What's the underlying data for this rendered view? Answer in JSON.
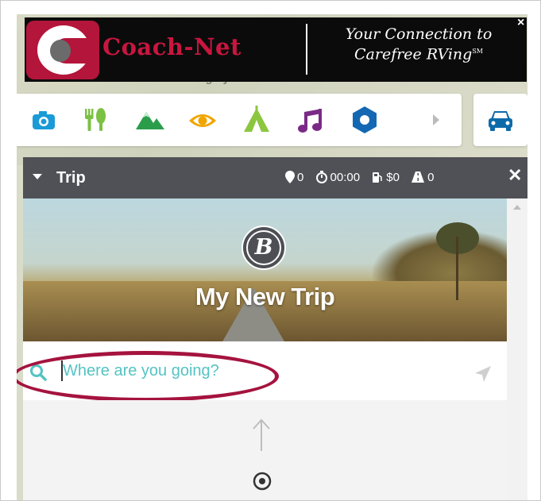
{
  "map": {
    "city_label": "Calgary"
  },
  "ad": {
    "brand": "Coach-Net",
    "tagline_line1": "Your Connection to",
    "tagline_line2": "Carefree RVing",
    "tagline_mark": "SM",
    "close_label": "×",
    "brand_color": "#c8163f"
  },
  "toolbar": {
    "categories": [
      {
        "icon": "camera-icon",
        "color": "#1a9bd7"
      },
      {
        "icon": "food-icon",
        "color": "#7bc142"
      },
      {
        "icon": "mountain-icon",
        "color": "#2a9d4b"
      },
      {
        "icon": "eye-icon",
        "color": "#f0a500"
      },
      {
        "icon": "tent-icon",
        "color": "#8cc63f"
      },
      {
        "icon": "music-icon",
        "color": "#7a2a86"
      },
      {
        "icon": "hexagon-icon",
        "color": "#1468b3"
      },
      {
        "icon": "chevron-right-icon",
        "color": "#bbbbbb"
      }
    ],
    "vehicle_icon": "car-icon",
    "vehicle_color": "#0d6aa8"
  },
  "trip": {
    "title": "Trip",
    "stops": "0",
    "duration": "00:00",
    "cost": "$0",
    "distance": "0",
    "close_label": "✕"
  },
  "hero": {
    "logo_letter": "B",
    "title": "My New Trip"
  },
  "search": {
    "placeholder": "Where are you going?",
    "accent": "#55c3c3"
  },
  "highlight_color": "#a5133e"
}
